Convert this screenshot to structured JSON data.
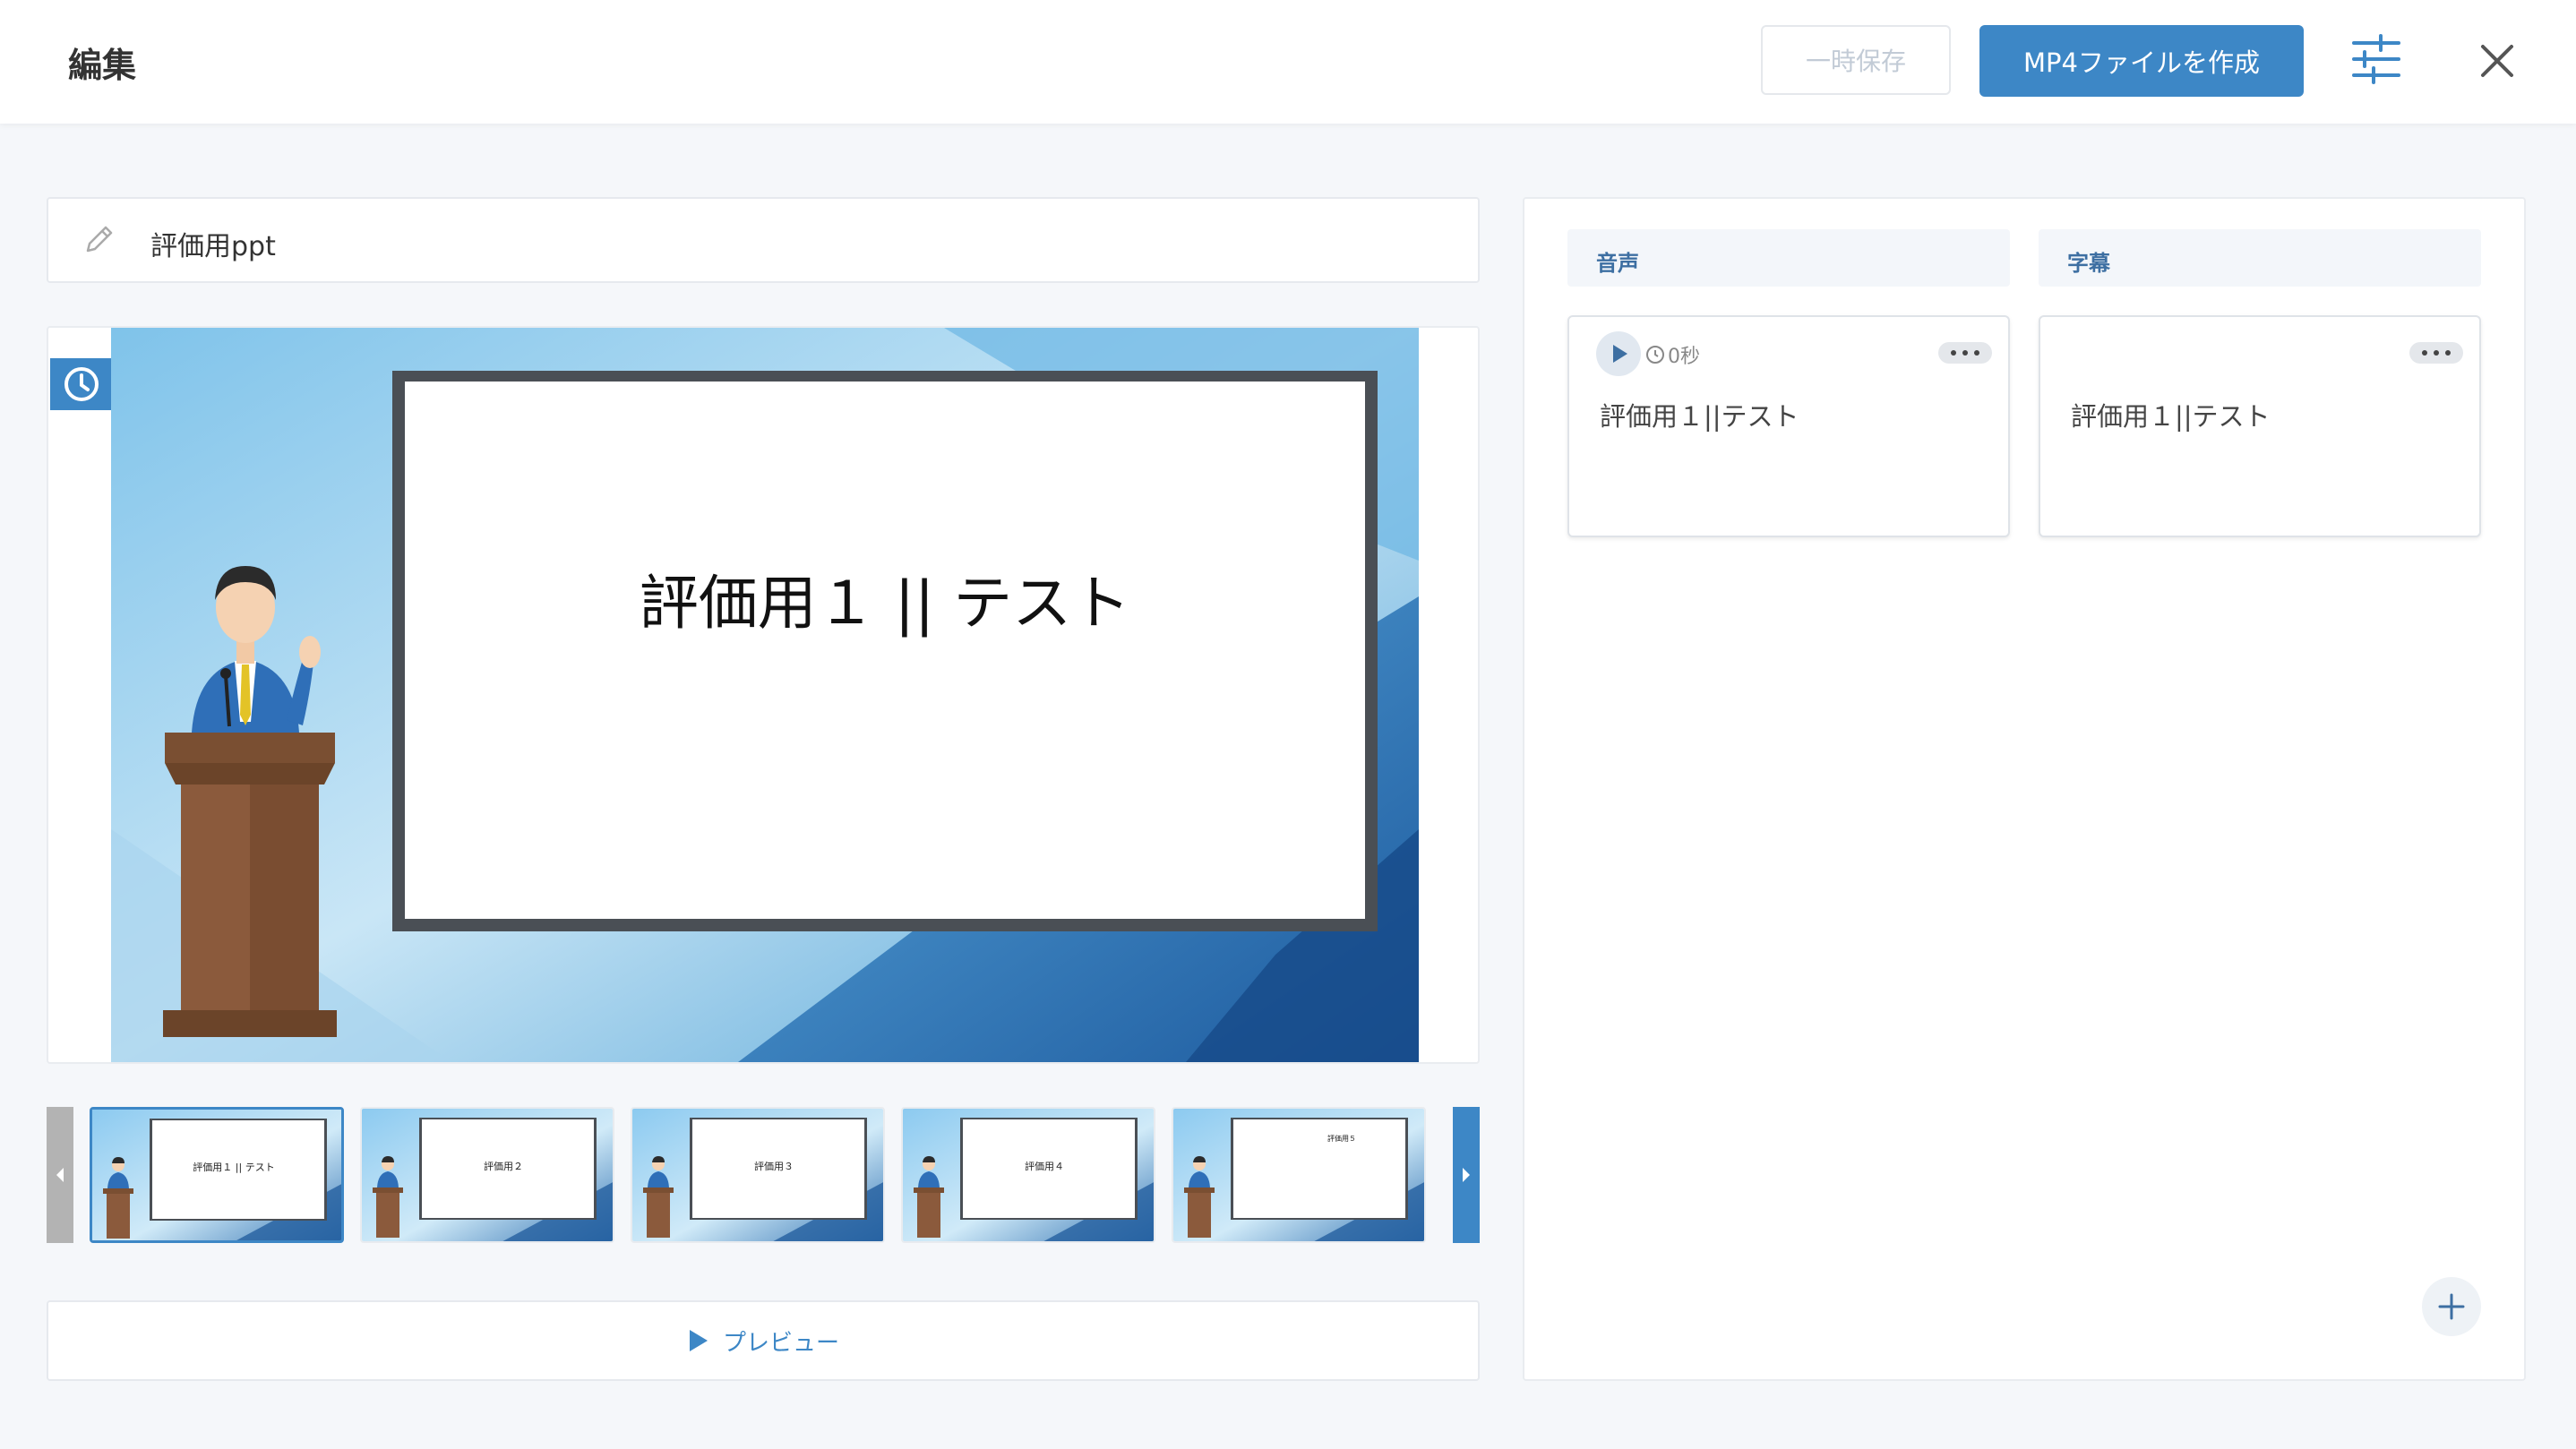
{
  "header": {
    "title": "編集",
    "save_label": "一時保存",
    "create_label": "MP4ファイルを作成"
  },
  "name_field": {
    "value": "評価用ppt"
  },
  "slide": {
    "title": "評価用１ ||  テスト"
  },
  "thumbnails": [
    {
      "label": "評価用１ || テスト"
    },
    {
      "label": "評価用２"
    },
    {
      "label": "評価用３"
    },
    {
      "label": "評価用４"
    },
    {
      "label": "評価用５"
    }
  ],
  "preview_label": "プレビュー",
  "columns": {
    "audio": {
      "header": "音声",
      "duration": "0秒",
      "text": "評価用１||テスト"
    },
    "subtitle": {
      "header": "字幕",
      "text": "評価用１||テスト"
    }
  },
  "colors": {
    "accent": "#3d87c6"
  }
}
